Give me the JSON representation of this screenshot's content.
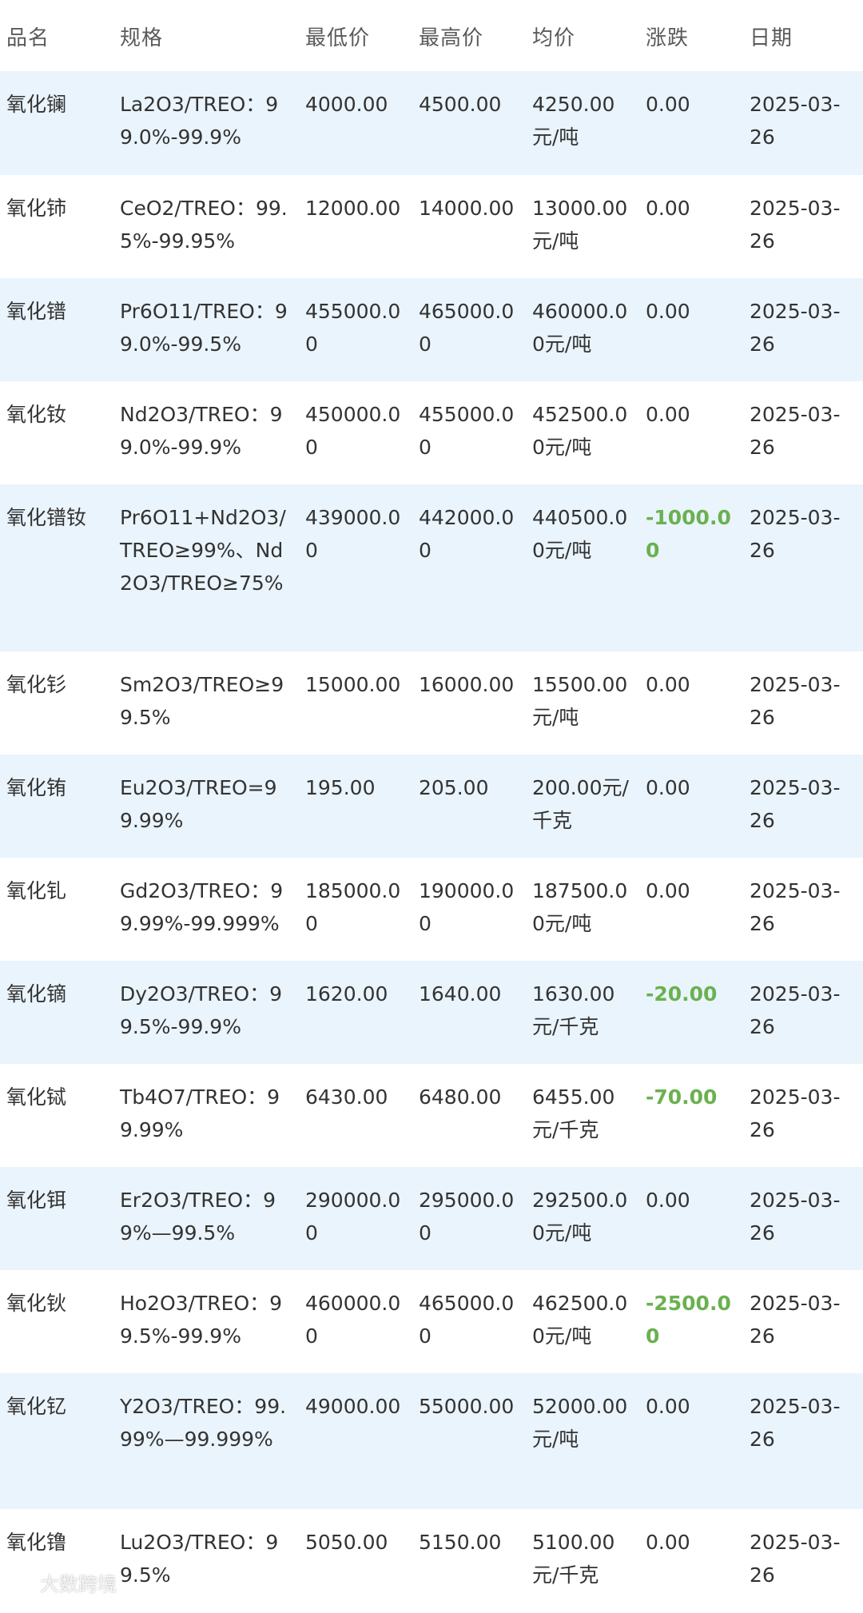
{
  "table": {
    "headers": [
      "品名",
      "规格",
      "最低价",
      "最高价",
      "均价",
      "涨跌",
      "日期"
    ],
    "rows": [
      {
        "name": "氧化镧",
        "spec": "La2O3/TREO：99.0%-99.9%",
        "low": "4000.00",
        "high": "4500.00",
        "avg": "4250.00元/吨",
        "change": "0.00",
        "date": "2025-03-26"
      },
      {
        "name": "氧化铈",
        "spec": "CeO2/TREO：99.5%-99.95%",
        "low": "12000.00",
        "high": "14000.00",
        "avg": "13000.00元/吨",
        "change": "0.00",
        "date": "2025-03-26"
      },
      {
        "name": "氧化镨",
        "spec": "Pr6O11/TREO：99.0%-99.5%",
        "low": "455000.00",
        "high": "465000.00",
        "avg": "460000.00元/吨",
        "change": "0.00",
        "date": "2025-03-26"
      },
      {
        "name": "氧化钕",
        "spec": "Nd2O3/TREO：99.0%-99.9%",
        "low": "450000.00",
        "high": "455000.00",
        "avg": "452500.00元/吨",
        "change": "0.00",
        "date": "2025-03-26"
      },
      {
        "name": "氧化镨钕",
        "spec": "Pr6O11+Nd2O3/TREO≥99%、Nd2O3/TREO≥75%",
        "low": "439000.00",
        "high": "442000.00",
        "avg": "440500.00元/吨",
        "change": "-1000.00",
        "date": "2025-03-26"
      },
      {
        "name": "氧化钐",
        "spec": "Sm2O3/TREO≥99.5%",
        "low": "15000.00",
        "high": "16000.00",
        "avg": "15500.00元/吨",
        "change": "0.00",
        "date": "2025-03-26"
      },
      {
        "name": "氧化铕",
        "spec": "Eu2O3/TREO=99.99%",
        "low": "195.00",
        "high": "205.00",
        "avg": "200.00元/千克",
        "change": "0.00",
        "date": "2025-03-26"
      },
      {
        "name": "氧化钆",
        "spec": "Gd2O3/TREO：99.99%-99.999%",
        "low": "185000.00",
        "high": "190000.00",
        "avg": "187500.00元/吨",
        "change": "0.00",
        "date": "2025-03-26"
      },
      {
        "name": "氧化镝",
        "spec": "Dy2O3/TREO：99.5%-99.9%",
        "low": "1620.00",
        "high": "1640.00",
        "avg": "1630.00元/千克",
        "change": "-20.00",
        "date": "2025-03-26"
      },
      {
        "name": "氧化铽",
        "spec": "Tb4O7/TREO：99.99%",
        "low": "6430.00",
        "high": "6480.00",
        "avg": "6455.00元/千克",
        "change": "-70.00",
        "date": "2025-03-26"
      },
      {
        "name": "氧化铒",
        "spec": "Er2O3/TREO：99%—99.5%",
        "low": "290000.00",
        "high": "295000.00",
        "avg": "292500.00元/吨",
        "change": "0.00",
        "date": "2025-03-26"
      },
      {
        "name": "氧化钬",
        "spec": "Ho2O3/TREO：99.5%-99.9%",
        "low": "460000.00",
        "high": "465000.00",
        "avg": "462500.00元/吨",
        "change": "-2500.00",
        "date": "2025-03-26"
      },
      {
        "name": "氧化钇",
        "spec": "Y2O3/TREO：99.99%—99.999%",
        "low": "49000.00",
        "high": "55000.00",
        "avg": "52000.00元/吨",
        "change": "0.00",
        "date": "2025-03-26"
      },
      {
        "name": "氧化镥",
        "spec": "Lu2O3/TREO：99.5%",
        "low": "5050.00",
        "high": "5150.00",
        "avg": "5100.00元/千克",
        "change": "0.00",
        "date": "2025-03-26"
      }
    ]
  },
  "colors": {
    "stripe": "#eaf4fc",
    "negative_change": "#6ab14f",
    "header_text": "#5a5a5a"
  },
  "watermark": {
    "text": "大数跨境",
    "icon": "logo-icon"
  }
}
